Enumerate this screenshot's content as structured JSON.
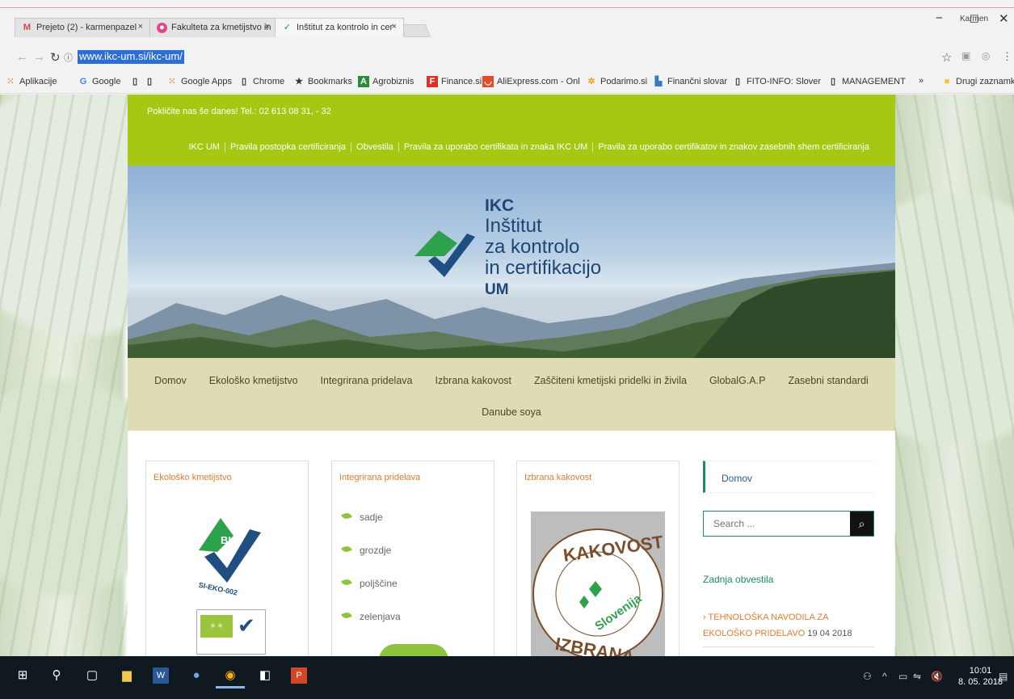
{
  "browser": {
    "tabs": [
      {
        "label": "Prejeto (2) - karmenpazel",
        "icon": "gmail-icon"
      },
      {
        "label": "Fakulteta za kmetijstvo in",
        "icon": "fk-icon"
      },
      {
        "label": "Inštitut za kontrolo in cer",
        "icon": "ikc-icon"
      }
    ],
    "user": "Karmen",
    "url": "www.ikc-um.si/ikc-um/",
    "bookmarks": [
      "Aplikacije",
      "Google",
      "Google Apps",
      "Chrome",
      "Bookmarks",
      "Agrobiznis",
      "Finance.si",
      "AliExpress.com - Onl",
      "Podarimo.si",
      "Finančni slovar",
      "FITO-INFO: Slovensk",
      "MANAGEMENT",
      "»",
      "Drugi zaznamki"
    ],
    "colors": {
      "accent_green": "#a7c813",
      "nav_beige": "#dedcb2",
      "orange": "#e07b32",
      "teal": "#1d8b5b"
    }
  },
  "site": {
    "phone": "Pokličite nas še danes! Tel.: 02 613 08 31, - 32",
    "top_nav": [
      "IKC UM",
      "Pravila postopka certificiranja",
      "Obvestila",
      "Pravila za uporabo certifikata in znaka IKC UM",
      "Pravila za uporabo certifikatov in znakov zasebnih shem certificiranja"
    ],
    "logo": {
      "line1": "IKC",
      "line2": "Inštitut",
      "line3": "za kontrolo",
      "line4": "in certifikacijo",
      "line5": "UM"
    },
    "main_nav_row1": [
      "Domov",
      "Ekološko kmetijstvo",
      "Integrirana pridelava",
      "Izbrana kakovost",
      "Zaščiteni kmetijski pridelki in živila",
      "GlobalG.A.P",
      "Zasebni standardi"
    ],
    "main_nav_row2": [
      "Danube soya"
    ],
    "cards": [
      {
        "title": "Ekološko kmetijstvo",
        "badge": "BIO",
        "badge_code": "SI-EKO-002"
      },
      {
        "title": "Integrirana pridelava",
        "items": [
          "sadje",
          "grozdje",
          "poljščine",
          "zelenjava"
        ]
      },
      {
        "title": "Izbrana kakovost",
        "stamp_top": "KAKOVOST",
        "stamp_bottom": "IZBRANA",
        "stamp_center": "Slovenija"
      }
    ],
    "sidebar": {
      "home": "Domov",
      "search_placeholder": "Search ...",
      "news_title": "Zadnja obvestila",
      "news_item": "TEHNOLOŠKA NAVODILA ZA EKOLOŠKO PRIDELAVO",
      "news_date": "19 04 2018"
    }
  },
  "taskbar": {
    "time": "10:01",
    "date": "8. 05. 2018"
  }
}
